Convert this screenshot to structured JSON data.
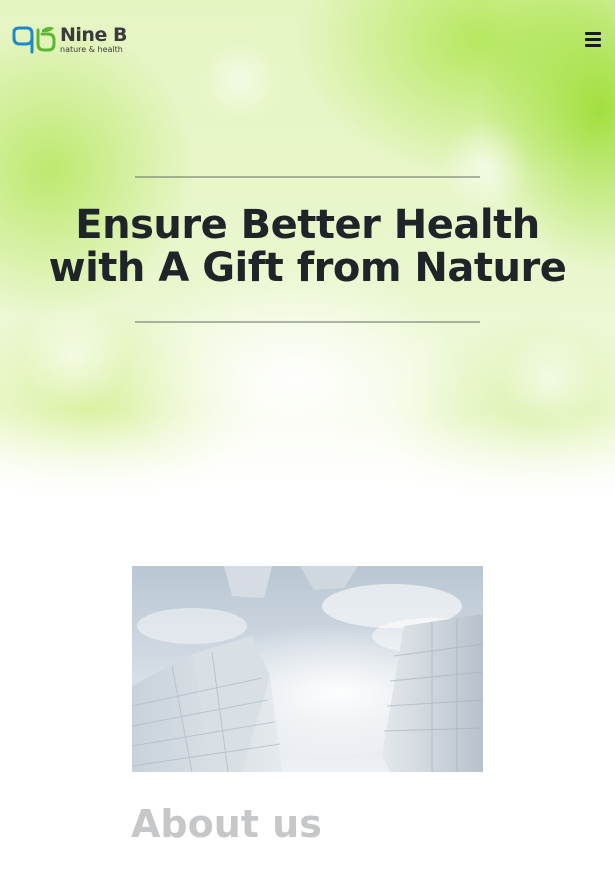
{
  "header": {
    "logo_name": "Nine B",
    "logo_tagline": "nature & health",
    "menu_icon": "hamburger-menu-icon"
  },
  "hero": {
    "headline_line1": "Ensure Better Health",
    "headline_line2": "with A Gift from Nature"
  },
  "about": {
    "title": "About us",
    "image_icon": "city-skyscrapers-photo"
  },
  "colors": {
    "brand_green": "#5fb534",
    "brand_blue": "#1e88c8",
    "headline_text": "#1f2428",
    "muted_heading": "#c5c7c9"
  }
}
